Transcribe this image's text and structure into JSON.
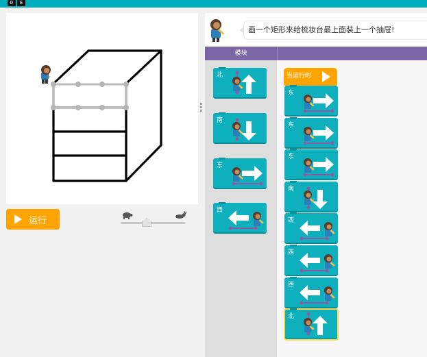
{
  "logo": {
    "letters": [
      "D",
      "E"
    ]
  },
  "canvas": {
    "description": ""
  },
  "run_button": {
    "label": "运行"
  },
  "speed_slider": {
    "value": 0.42,
    "slow_icon": "turtle-icon",
    "fast_icon": "rabbit-icon"
  },
  "instructions": {
    "text": "画一个矩形来给梳妆台最上面装上一个抽屉!"
  },
  "header": {
    "toolbox_label": "模块"
  },
  "toolbox": {
    "blocks": [
      {
        "label": "北",
        "arrow": "up"
      },
      {
        "label": "南",
        "arrow": "down"
      },
      {
        "label": "东",
        "arrow": "right"
      },
      {
        "label": "西",
        "arrow": "left"
      }
    ]
  },
  "workspace": {
    "hat_label": "当运行时",
    "blocks": [
      {
        "label": "东",
        "arrow": "right"
      },
      {
        "label": "东",
        "arrow": "right"
      },
      {
        "label": "东",
        "arrow": "right"
      },
      {
        "label": "南",
        "arrow": "down"
      },
      {
        "label": "西",
        "arrow": "left"
      },
      {
        "label": "西",
        "arrow": "left"
      },
      {
        "label": "西",
        "arrow": "left"
      },
      {
        "label": "北",
        "arrow": "up"
      }
    ]
  },
  "colors": {
    "top_bar": "#00adbc",
    "block": "#0fb0bd",
    "hat_block": "#ffa400",
    "run_button": "#ffa400",
    "header": "#7b67a6",
    "path": "#8e5aa6"
  }
}
